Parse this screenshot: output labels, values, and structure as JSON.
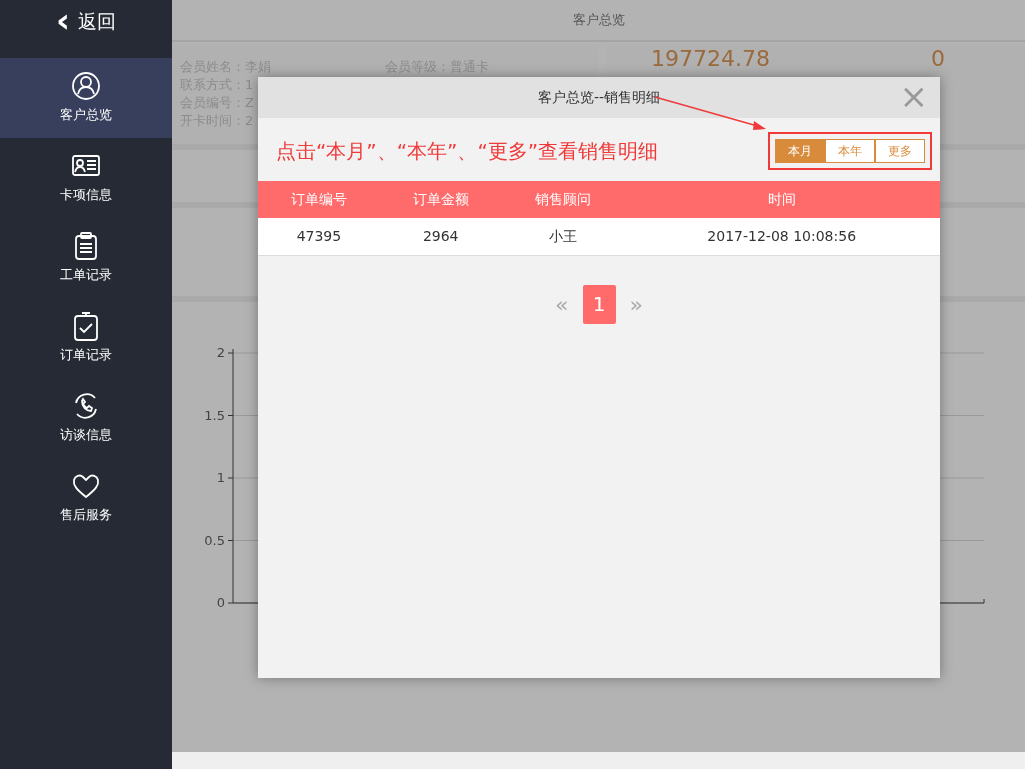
{
  "sidebar": {
    "back": {
      "icon": "‹",
      "label": "返回"
    },
    "items": [
      {
        "label": "客户总览",
        "selected": true
      },
      {
        "label": "卡项信息",
        "selected": false
      },
      {
        "label": "工单记录",
        "selected": false
      },
      {
        "label": "订单记录",
        "selected": false
      },
      {
        "label": "访谈信息",
        "selected": false
      },
      {
        "label": "售后服务",
        "selected": false
      }
    ]
  },
  "page": {
    "title": "客户总览",
    "member_info": {
      "left": [
        "会员姓名：李娟",
        "联系方式：1",
        "会员编号：Z",
        "开卡时间：2"
      ],
      "right": [
        "会员等级：普通卡"
      ]
    },
    "stats": [
      "197724.78",
      "0"
    ],
    "chart": {
      "yticks": [
        "2",
        "1.5",
        "1",
        "0.5",
        "0"
      ]
    }
  },
  "modal": {
    "title": "客户总览--销售明细",
    "close": "×",
    "annotation": "点击“本月”、“本年”、“更多”查看销售明细",
    "periods": [
      {
        "label": "本月",
        "selected": true
      },
      {
        "label": "本年",
        "selected": false
      },
      {
        "label": "更多",
        "selected": false
      }
    ],
    "table": {
      "columns": [
        "订单编号",
        "订单金额",
        "销售顾问",
        "时间"
      ],
      "rows": [
        [
          "47395",
          "2964",
          "小王",
          "2017-12-08 10:08:56"
        ]
      ]
    },
    "pagination": {
      "prev": "«",
      "pages": [
        {
          "label": "1",
          "selected": true
        }
      ],
      "next": "»"
    }
  }
}
